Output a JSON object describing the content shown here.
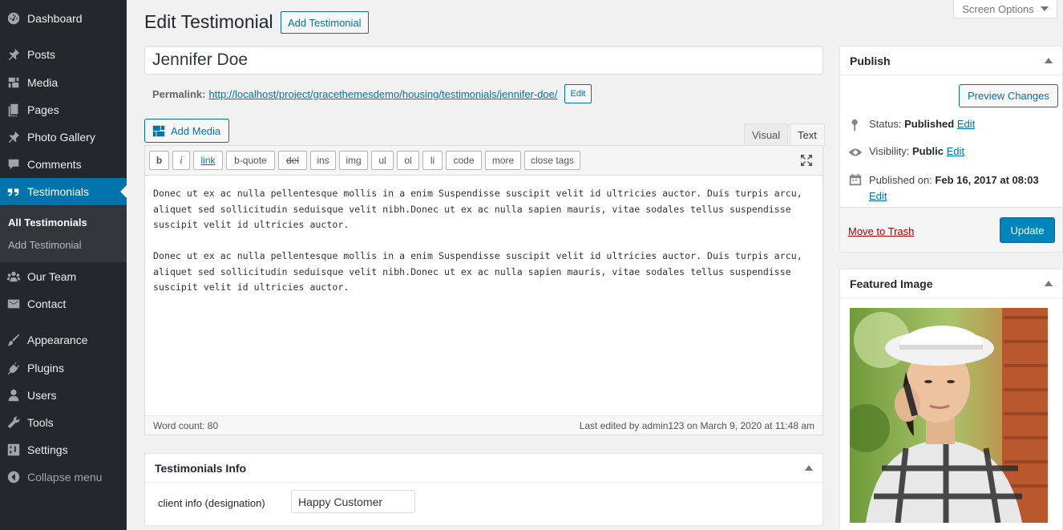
{
  "sidebar": {
    "items": [
      {
        "label": "Dashboard",
        "icon": "dashboard-icon"
      },
      {
        "label": "Posts",
        "icon": "pin-icon"
      },
      {
        "label": "Media",
        "icon": "media-icon"
      },
      {
        "label": "Pages",
        "icon": "pages-icon"
      },
      {
        "label": "Photo Gallery",
        "icon": "pin-icon"
      },
      {
        "label": "Comments",
        "icon": "comment-icon"
      },
      {
        "label": "Testimonials",
        "icon": "quote-icon"
      },
      {
        "label": "Our Team",
        "icon": "team-icon"
      },
      {
        "label": "Contact",
        "icon": "mail-icon"
      },
      {
        "label": "Appearance",
        "icon": "brush-icon"
      },
      {
        "label": "Plugins",
        "icon": "plug-icon"
      },
      {
        "label": "Users",
        "icon": "user-icon"
      },
      {
        "label": "Tools",
        "icon": "wrench-icon"
      },
      {
        "label": "Settings",
        "icon": "settings-icon"
      },
      {
        "label": "Collapse menu",
        "icon": "collapse-icon"
      }
    ],
    "submenu": [
      "All Testimonials",
      "Add Testimonial"
    ]
  },
  "header": {
    "title": "Edit Testimonial",
    "add_new": "Add Testimonial",
    "screen_options": "Screen Options"
  },
  "post": {
    "title": "Jennifer Doe",
    "permalink_label": "Permalink:",
    "permalink_base": "http://localhost/project/gracethemesdemo/housing/testimonials/",
    "permalink_slug": "jennifer-doe",
    "permalink_end": "/",
    "permalink_edit": "Edit"
  },
  "editor": {
    "add_media": "Add Media",
    "tab_visual": "Visual",
    "tab_text": "Text",
    "quicktags": [
      "b",
      "i",
      "link",
      "b-quote",
      "del",
      "ins",
      "img",
      "ul",
      "ol",
      "li",
      "code",
      "more",
      "close tags"
    ],
    "paragraphs": [
      "Donec ut ex ac nulla pellentesque mollis in a enim Suspendisse suscipit velit id ultricies auctor. Duis turpis arcu, aliquet sed sollicitudin seduisque velit nibh.Donec ut ex ac nulla sapien mauris, vitae sodales tellus suspendisse suscipit velit id ultricies auctor.",
      "Donec ut ex ac nulla pellentesque mollis in a enim Suspendisse suscipit velit id ultricies auctor. Duis turpis arcu, aliquet sed sollicitudin seduisque velit nibh.Donec ut ex ac nulla sapien mauris, vitae sodales tellus suspendisse suscipit velit id ultricies auctor."
    ],
    "word_count": "Word count: 80",
    "last_edited": "Last edited by admin123 on March 9, 2020 at 11:48 am"
  },
  "testimonials_info": {
    "title": "Testimonials Info",
    "label": "client info (designation)",
    "value": "Happy Customer"
  },
  "publish": {
    "title": "Publish",
    "preview": "Preview Changes",
    "status_label": "Status:",
    "status_value": "Published",
    "visibility_label": "Visibility:",
    "visibility_value": "Public",
    "published_label": "Published on:",
    "published_value": "Feb 16, 2017 at 08:03",
    "edit": "Edit",
    "trash": "Move to Trash",
    "update": "Update"
  },
  "featured": {
    "title": "Featured Image"
  },
  "colors": {
    "sidebar_bg": "#23282d",
    "accent": "#0073aa",
    "primary_button": "#0085ba",
    "trash": "#aa0000"
  }
}
